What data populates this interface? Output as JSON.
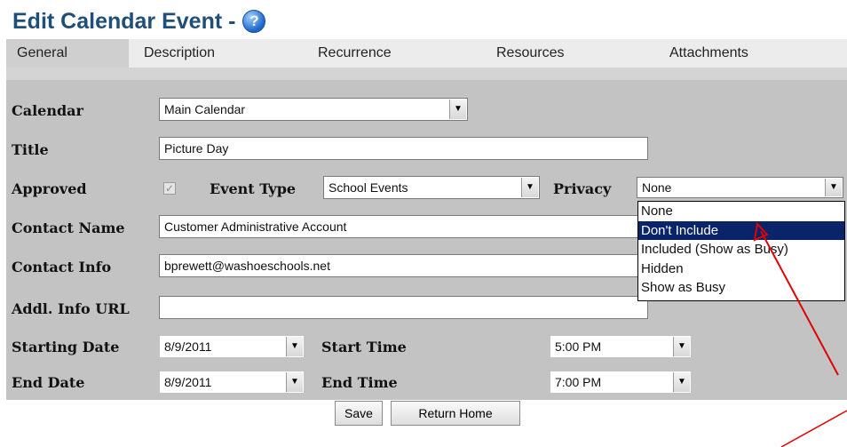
{
  "page": {
    "title": "Edit Calendar Event -",
    "help_glyph": "?"
  },
  "tabs": [
    {
      "label": "General"
    },
    {
      "label": "Description"
    },
    {
      "label": "Recurrence"
    },
    {
      "label": "Resources"
    },
    {
      "label": "Attachments"
    }
  ],
  "form": {
    "calendar": {
      "label": "Calendar",
      "value": "Main Calendar"
    },
    "title": {
      "label": "Title",
      "value": "Picture Day"
    },
    "approved": {
      "label": "Approved",
      "checked": true,
      "check_glyph": "✓"
    },
    "event_type": {
      "label": "Event Type",
      "value": "School Events"
    },
    "privacy": {
      "label": "Privacy",
      "value": "None",
      "options": [
        "None",
        "Don't Include",
        "Included (Show as Busy)",
        "Hidden",
        "Show as Busy"
      ],
      "highlighted": "Don't Include"
    },
    "contact_name": {
      "label": "Contact Name",
      "value": "Customer Administrative Account"
    },
    "contact_info": {
      "label": "Contact Info",
      "value": "bprewett@washoeschools.net"
    },
    "addl_info_url": {
      "label": "Addl. Info URL",
      "value": ""
    },
    "starting_date": {
      "label": "Starting Date",
      "value": "8/9/2011"
    },
    "start_time": {
      "label": "Start Time",
      "value": "5:00 PM"
    },
    "end_date": {
      "label": "End Date",
      "value": "8/9/2011"
    },
    "end_time": {
      "label": "End Time",
      "value": "7:00 PM"
    }
  },
  "buttons": {
    "save": "Save",
    "return_home": "Return Home"
  },
  "icons": {
    "dropdown": "▼",
    "help": "help-icon"
  },
  "colors": {
    "title": "#1f4e79",
    "highlight": "#0a246a",
    "annotation": "#e00000"
  }
}
